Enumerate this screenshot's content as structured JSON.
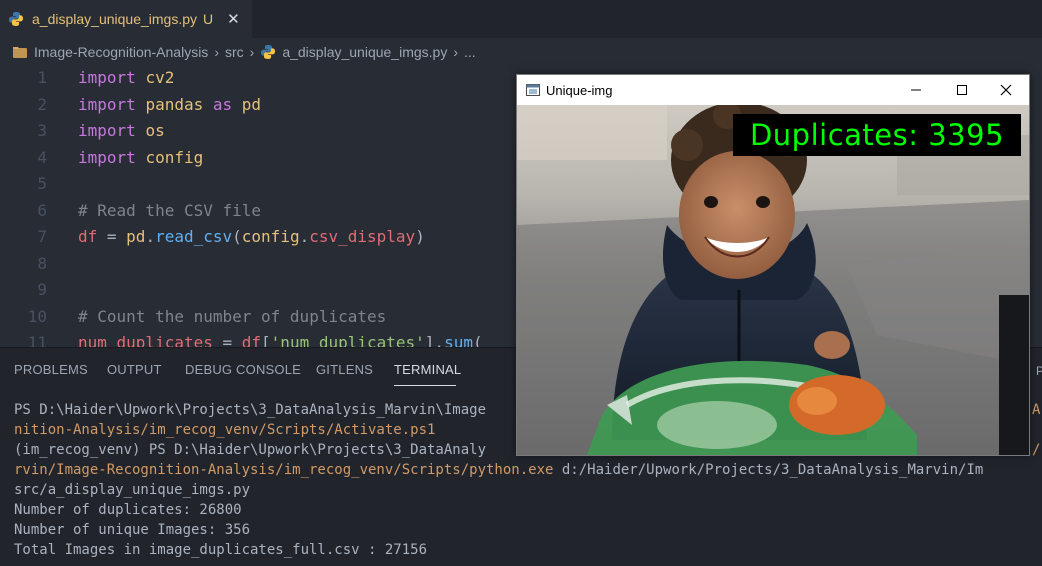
{
  "tab": {
    "filename": "a_display_unique_imgs.py",
    "modified": "U",
    "close": "✕"
  },
  "breadcrumb": {
    "root": "Image-Recognition-Analysis",
    "folder": "src",
    "file": "a_display_unique_imgs.py",
    "more": "..."
  },
  "editor": {
    "lines": [
      {
        "n": "1",
        "tokens": [
          [
            "kw",
            "import"
          ],
          [
            "pl",
            " "
          ],
          [
            "id",
            "cv2"
          ]
        ]
      },
      {
        "n": "2",
        "tokens": [
          [
            "kw",
            "import"
          ],
          [
            "pl",
            " "
          ],
          [
            "id",
            "pandas"
          ],
          [
            "pl",
            " "
          ],
          [
            "kw",
            "as"
          ],
          [
            "pl",
            " "
          ],
          [
            "id",
            "pd"
          ]
        ]
      },
      {
        "n": "3",
        "tokens": [
          [
            "kw",
            "import"
          ],
          [
            "pl",
            " "
          ],
          [
            "id",
            "os"
          ]
        ]
      },
      {
        "n": "4",
        "tokens": [
          [
            "kw",
            "import"
          ],
          [
            "pl",
            " "
          ],
          [
            "id",
            "config"
          ]
        ]
      },
      {
        "n": "5",
        "tokens": []
      },
      {
        "n": "6",
        "tokens": [
          [
            "cm",
            "# Read the CSV file"
          ]
        ]
      },
      {
        "n": "7",
        "tokens": [
          [
            "var",
            "df"
          ],
          [
            "pl",
            " = "
          ],
          [
            "id",
            "pd"
          ],
          [
            "pl",
            "."
          ],
          [
            "fn",
            "read_csv"
          ],
          [
            "pl",
            "("
          ],
          [
            "id",
            "config"
          ],
          [
            "pl",
            "."
          ],
          [
            "var",
            "csv_display"
          ],
          [
            "pl",
            ")"
          ]
        ]
      },
      {
        "n": "8",
        "tokens": []
      },
      {
        "n": "9",
        "tokens": []
      },
      {
        "n": "10",
        "tokens": [
          [
            "cm",
            "# Count the number of duplicates"
          ]
        ]
      },
      {
        "n": "11",
        "tokens": [
          [
            "var",
            "num_duplicates"
          ],
          [
            "pl",
            " = "
          ],
          [
            "var",
            "df"
          ],
          [
            "pl",
            "["
          ],
          [
            "str",
            "'num_duplicates'"
          ],
          [
            "pl",
            "]."
          ],
          [
            "fn",
            "sum"
          ],
          [
            "pl",
            "("
          ]
        ]
      }
    ]
  },
  "panel": {
    "tabs": [
      "PROBLEMS",
      "OUTPUT",
      "DEBUG CONSOLE",
      "GITLENS",
      "TERMINAL"
    ],
    "active_tab": "TERMINAL",
    "right_peek": "P"
  },
  "terminal": {
    "lines": [
      {
        "segs": [
          [
            "pl",
            "PS D:\\Haider\\Upwork\\Projects\\3_DataAnalysis_Marvin\\Image"
          ]
        ],
        "right": [
          "orange",
          "A"
        ]
      },
      {
        "segs": [
          [
            "orange",
            "nition-Analysis/im_recog_venv/Scripts/Activate.ps1"
          ]
        ]
      },
      {
        "segs": [
          [
            "pl",
            "(im_recog_venv) PS D:\\Haider\\Upwork\\Projects\\3_DataAnaly"
          ]
        ],
        "right": [
          "orange",
          "/"
        ]
      },
      {
        "segs": [
          [
            "orange",
            "rvin/Image-Recognition-Analysis/im_recog_venv/Scripts/python.exe"
          ],
          [
            "pl",
            " d:/Haider/Upwork/Projects/3_DataAnalysis_Marvin/Im"
          ]
        ]
      },
      {
        "segs": [
          [
            "pl",
            "src/a_display_unique_imgs.py"
          ]
        ]
      },
      {
        "segs": [
          [
            "pl",
            "Number of duplicates: 26800"
          ]
        ]
      },
      {
        "segs": [
          [
            "pl",
            "Number of unique Images: 356"
          ]
        ]
      },
      {
        "segs": [
          [
            "pl",
            "Total Images in image_duplicates_full.csv : 27156"
          ]
        ]
      }
    ]
  },
  "window": {
    "title": "Unique-img",
    "overlay_text": "Duplicates: 3395",
    "overlay_color": "#00ff00"
  }
}
